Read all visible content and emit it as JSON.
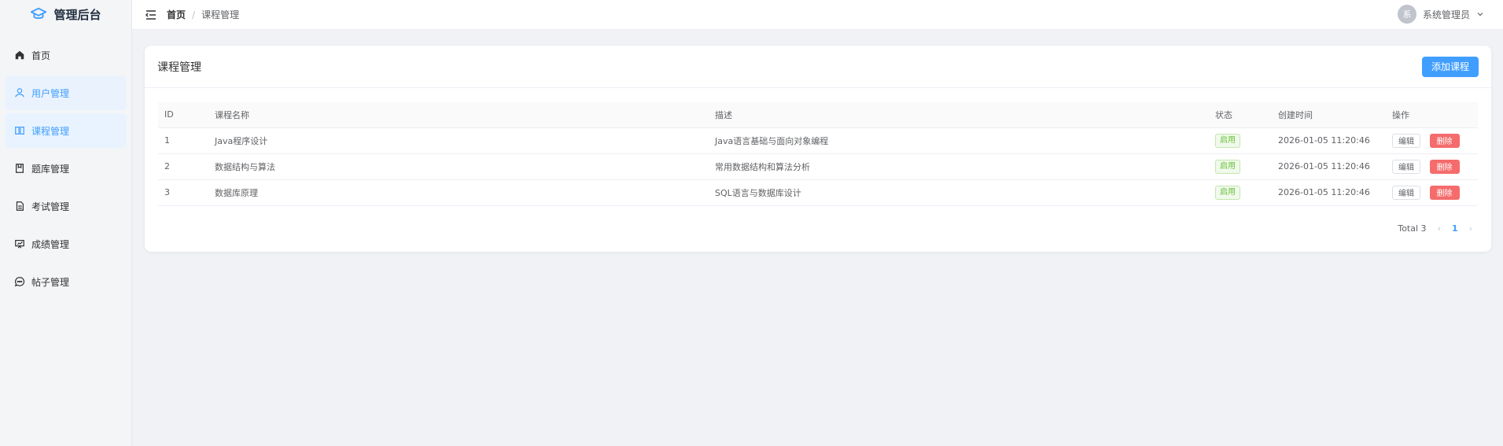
{
  "app": {
    "title": "管理后台"
  },
  "sidebar": {
    "items": [
      {
        "label": "首页",
        "icon": "home-icon"
      },
      {
        "label": "用户管理",
        "icon": "user-icon"
      },
      {
        "label": "课程管理",
        "icon": "book-icon"
      },
      {
        "label": "题库管理",
        "icon": "question-bank-icon"
      },
      {
        "label": "考试管理",
        "icon": "document-icon"
      },
      {
        "label": "成绩管理",
        "icon": "presentation-icon"
      },
      {
        "label": "帖子管理",
        "icon": "chat-icon"
      }
    ]
  },
  "header": {
    "breadcrumb": {
      "home": "首页",
      "separator": "/",
      "current": "课程管理"
    },
    "user": {
      "avatar_text": "系",
      "name": "系统管理员"
    }
  },
  "main": {
    "title": "课程管理",
    "add_button": "添加课程",
    "table": {
      "columns": [
        "ID",
        "课程名称",
        "描述",
        "状态",
        "创建时间",
        "操作"
      ],
      "rows": [
        {
          "id": "1",
          "name": "Java程序设计",
          "desc": "Java语言基础与面向对象编程",
          "status": "启用",
          "created": "2026-01-05 11:20:46",
          "edit": "编辑",
          "delete": "删除"
        },
        {
          "id": "2",
          "name": "数据结构与算法",
          "desc": "常用数据结构和算法分析",
          "status": "启用",
          "created": "2026-01-05 11:20:46",
          "edit": "编辑",
          "delete": "删除"
        },
        {
          "id": "3",
          "name": "数据库原理",
          "desc": "SQL语言与数据库设计",
          "status": "启用",
          "created": "2026-01-05 11:20:46",
          "edit": "编辑",
          "delete": "删除"
        }
      ]
    },
    "pagination": {
      "total": "Total 3",
      "current_page": "1",
      "prev": "‹",
      "next": "›"
    }
  },
  "colors": {
    "primary": "#409eff",
    "danger": "#f56c6c",
    "success": "#67c23a"
  }
}
